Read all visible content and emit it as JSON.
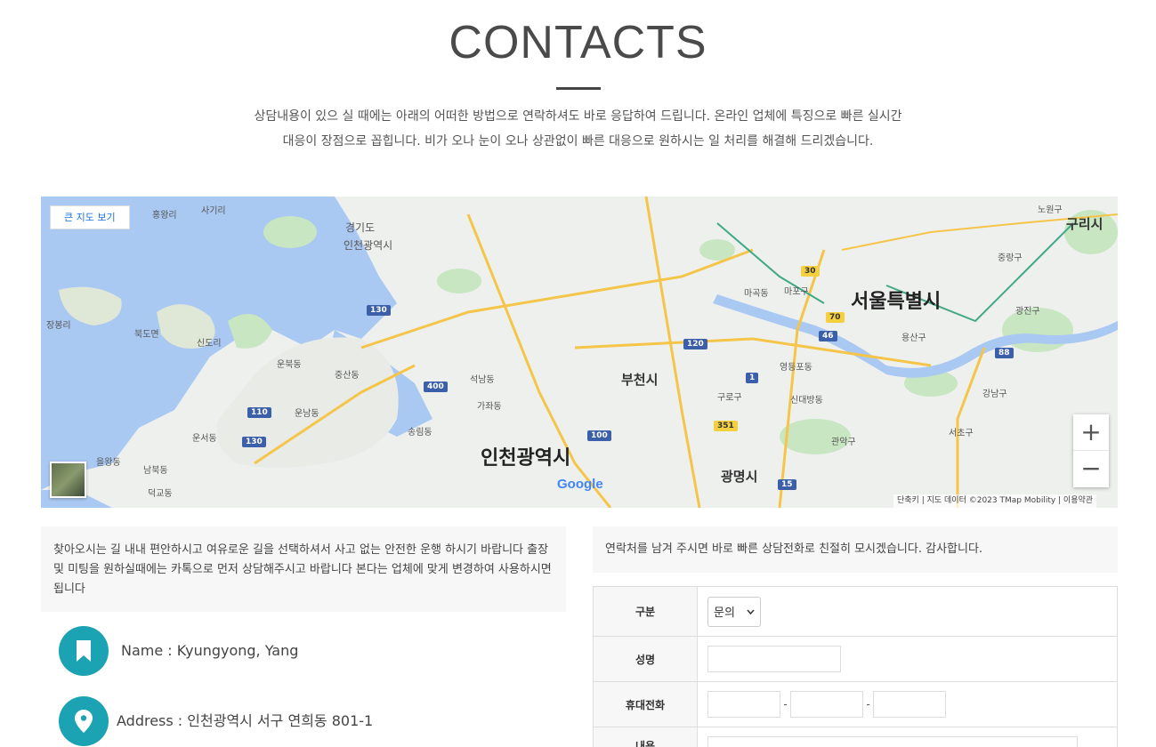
{
  "header": {
    "title": "CONTACTS",
    "intro_line1": "상담내용이 있으 실 때에는 아래의 어떠한 방법으로 연락하셔도 바로 응답하여 드립니다. 온라인 업체에 특징으로 빠른 실시간",
    "intro_line2": "대응이 장점으로 꼽힙니다. 비가 오나 눈이 오나 상관없이 빠른 대응으로 원하시는 일 처리를 해결해 드리겠습니다."
  },
  "map": {
    "big_map_button": "큰 지도 보기",
    "zoom_in": "+",
    "zoom_out": "−",
    "google": "Google",
    "attribution": "단축키  |  지도 데이터 ©2023 TMap Mobility  |  이용약관",
    "labels": {
      "seoul": "서울특별시",
      "incheon": "인천광역시",
      "bucheon": "부천시",
      "gwangmyeong": "광명시",
      "guri": "구리시",
      "gyeonggi": "경기도",
      "incheon_small": "인천광역시",
      "yeongjong": "운북동",
      "junsan": "중산동",
      "unnam": "운남동",
      "unseo": "운서동",
      "bukdo": "북도면",
      "sindo": "신도리",
      "sambong": "장봉리",
      "eulwang": "을왕동",
      "namboo": "남북동",
      "deokgyo": "덕교동",
      "ganghwa": "홍왕리",
      "sagiri": "사기리",
      "seoknam": "석남동",
      "gajwa": "가좌동",
      "songnim": "송림동",
      "magok": "마곡동",
      "yeongdeungpo": "영등포동",
      "guro": "구로구",
      "gwanak": "관악구",
      "gangnam": "강남구",
      "yongsan": "용산구",
      "mapo": "마포구",
      "gwangjin": "광진구",
      "seocho": "서초구",
      "jungnang": "중랑구",
      "nowon": "노원구",
      "sindaebang": "신대방동"
    },
    "shields": {
      "r130a": "130",
      "r130b": "130",
      "r110": "110",
      "r400": "400",
      "r100": "100",
      "r120": "120",
      "r88": "88",
      "r46": "46",
      "r1": "1",
      "r15": "15",
      "r351": "351",
      "r70": "70",
      "r30": "30"
    }
  },
  "left": {
    "notice": "찾아오시는 길 내내 편안하시고 여유로운 길을 선택하셔서 사고 없는 안전한 운행 하시기 바랍니다 출장 및 미팅을 원하실때에는 카톡으로 먼저 상담해주시고 바랍니다 본다는 업체에 맞게 변경하여 사용하시면 됩니다",
    "name": "Name : Kyungyong, Yang",
    "address": "Address : 인천광역시 서구 연희동 801-1"
  },
  "right": {
    "notice": "연락처를 남겨 주시면 바로 빠른 상담전화로 친절히 모시겠습니다. 감사합니다.",
    "form": {
      "category_label": "구분",
      "category_value": "문의",
      "name_label": "성명",
      "phone_label": "휴대전화",
      "phone_sep": "-",
      "content_label": "내용"
    }
  },
  "colors": {
    "accent": "#1ba3b4",
    "water": "#a9c8f2",
    "land": "#eef0ee",
    "park": "#c8e6c2",
    "highway": "#f5c54a"
  }
}
